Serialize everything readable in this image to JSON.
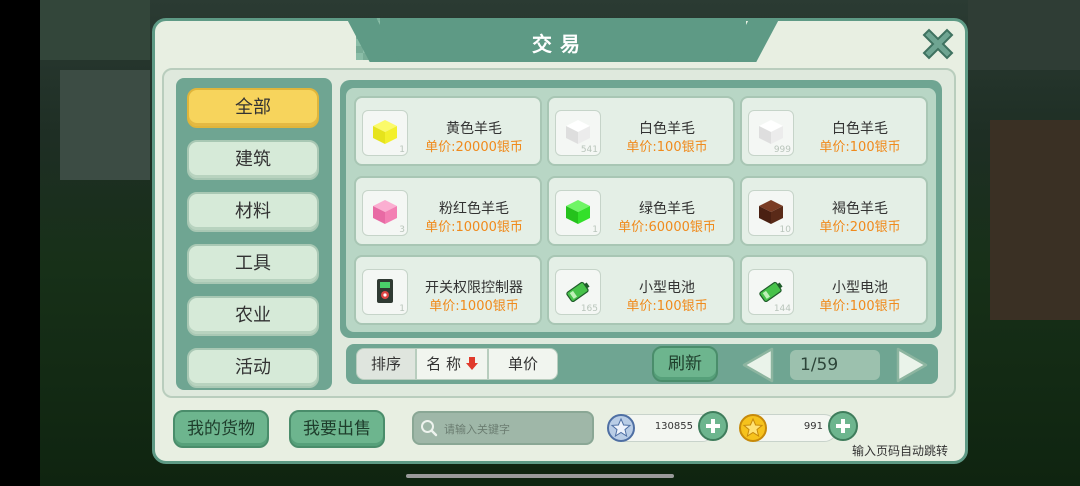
{
  "title": "交易",
  "categories": [
    {
      "label": "全部",
      "active": true
    },
    {
      "label": "建筑",
      "active": false
    },
    {
      "label": "材料",
      "active": false
    },
    {
      "label": "工具",
      "active": false
    },
    {
      "label": "农业",
      "active": false
    },
    {
      "label": "活动",
      "active": false
    }
  ],
  "items": [
    {
      "name": "黄色羊毛",
      "price": "单价:20000银币",
      "count": "1",
      "icon": "yellow-wool-icon",
      "color": "#f3f02c"
    },
    {
      "name": "白色羊毛",
      "price": "单价:100银币",
      "count": "541",
      "icon": "white-wool-icon",
      "color": "#f3f3f3"
    },
    {
      "name": "白色羊毛",
      "price": "单价:100银币",
      "count": "999",
      "icon": "white-wool-icon",
      "color": "#f3f3f3"
    },
    {
      "name": "粉红色羊毛",
      "price": "单价:10000银币",
      "count": "3",
      "icon": "pink-wool-icon",
      "color": "#f37fb3"
    },
    {
      "name": "绿色羊毛",
      "price": "单价:60000银币",
      "count": "1",
      "icon": "green-wool-icon",
      "color": "#33e02a"
    },
    {
      "name": "褐色羊毛",
      "price": "单价:200银币",
      "count": "10",
      "icon": "brown-wool-icon",
      "color": "#5a2a18"
    },
    {
      "name": "开关权限控制器",
      "price": "单价:1000银币",
      "count": "1",
      "icon": "switch-controller-icon",
      "color": "#3b4a3e"
    },
    {
      "name": "小型电池",
      "price": "单价:100银币",
      "count": "165",
      "icon": "battery-icon",
      "color": "#47c24a"
    },
    {
      "name": "小型电池",
      "price": "单价:100银币",
      "count": "144",
      "icon": "battery-icon",
      "color": "#47c24a"
    }
  ],
  "sort": {
    "label": "排序",
    "name": "名 称",
    "price": "单价"
  },
  "refresh_label": "刷新",
  "pagination": {
    "current": "1/59"
  },
  "buttons": {
    "my_goods": "我的货物",
    "sell": "我要出售"
  },
  "search": {
    "placeholder": "请输入关键字"
  },
  "currency": {
    "silver": "130855",
    "gold": "991"
  },
  "hint": "输入页码自动跳转"
}
